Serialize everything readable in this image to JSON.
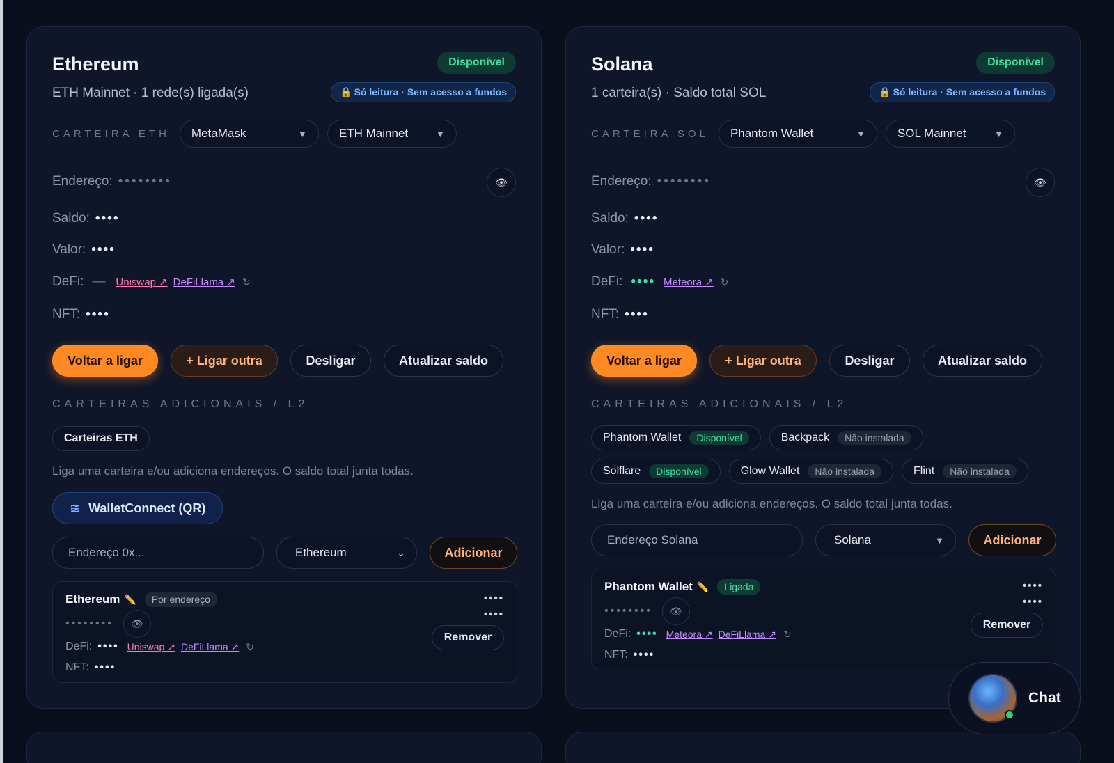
{
  "eth": {
    "title": "Ethereum",
    "subtitle": "ETH Mainnet · 1 rede(s) ligada(s)",
    "status": "Disponível",
    "readonly": "Só leitura · Sem acesso a fundos",
    "wallet_label": "CARTEIRA ETH",
    "wallet_select": "MetaMask",
    "network_select": "ETH Mainnet",
    "address_label": "Endereço:",
    "address_value": "••••••••",
    "balance_label": "Saldo:",
    "balance_value": "••••",
    "value_label": "Valor:",
    "value_value": "••••",
    "defi_label": "DeFi:",
    "defi_value": "—",
    "defi_links": [
      "Uniswap ↗",
      "DeFiLlama ↗"
    ],
    "nft_label": "NFT:",
    "nft_value": "••••",
    "buttons": [
      "Voltar a ligar",
      "+ Ligar outra",
      "Desligar",
      "Atualizar saldo"
    ],
    "section_label": "CARTEIRAS ADICIONAIS / L2",
    "chips": [
      {
        "label": "Carteiras ETH"
      }
    ],
    "help_text": "Liga uma carteira e/ou adiciona endereços. O saldo total junta todas.",
    "walletconnect": "WalletConnect (QR)",
    "input_placeholder": "Endereço 0x...",
    "chain_select": "Ethereum",
    "add_button": "Adicionar",
    "entry": {
      "title": "Ethereum",
      "tag": "Por endereço",
      "address": "••••••••",
      "defi_label": "DeFi:",
      "defi_value": "••••",
      "links": [
        "Uniswap ↗",
        "DeFiLlama ↗"
      ],
      "nft_label": "NFT:",
      "nft_value": "••••",
      "remove": "Remover"
    }
  },
  "sol": {
    "title": "Solana",
    "subtitle": "1 carteira(s) · Saldo total SOL",
    "status": "Disponível",
    "readonly": "Só leitura · Sem acesso a fundos",
    "wallet_label": "CARTEIRA SOL",
    "wallet_select": "Phantom Wallet",
    "network_select": "SOL Mainnet",
    "address_label": "Endereço:",
    "address_value": "••••••••",
    "balance_label": "Saldo:",
    "balance_value": "••••",
    "value_label": "Valor:",
    "value_value": "••••",
    "defi_label": "DeFi:",
    "defi_value": "••••",
    "defi_links": [
      "Meteora ↗"
    ],
    "nft_label": "NFT:",
    "nft_value": "••••",
    "buttons": [
      "Voltar a ligar",
      "+ Ligar outra",
      "Desligar",
      "Atualizar saldo"
    ],
    "section_label": "CARTEIRAS ADICIONAIS / L2",
    "chips": [
      {
        "label": "Phantom Wallet",
        "tag": "Disponível"
      },
      {
        "label": "Backpack",
        "tag": "Não instalada"
      },
      {
        "label": "Solflare",
        "tag": "Disponível"
      },
      {
        "label": "Glow Wallet",
        "tag": "Não instalada"
      },
      {
        "label": "Flint",
        "tag": "Não instalada"
      }
    ],
    "help_text": "Liga uma carteira e/ou adiciona endereços. O saldo total junta todas.",
    "input_placeholder": "Endereço Solana",
    "chain_select": "Solana",
    "add_button": "Adicionar",
    "entry": {
      "title": "Phantom Wallet",
      "tag": "Ligada",
      "address": "••••••••",
      "defi_label": "DeFi:",
      "defi_value": "••••",
      "links": [
        "Meteora ↗",
        "DeFiLlama ↗"
      ],
      "nft_label": "NFT:",
      "nft_value": "••••",
      "remove": "Remover"
    }
  },
  "menu_dots": "••••",
  "chat": {
    "label": "Chat"
  },
  "colors": {
    "accent": "#ff8a24",
    "available": "#3ee0a6",
    "link": "#c68bff",
    "background": "#0a0f1e"
  }
}
